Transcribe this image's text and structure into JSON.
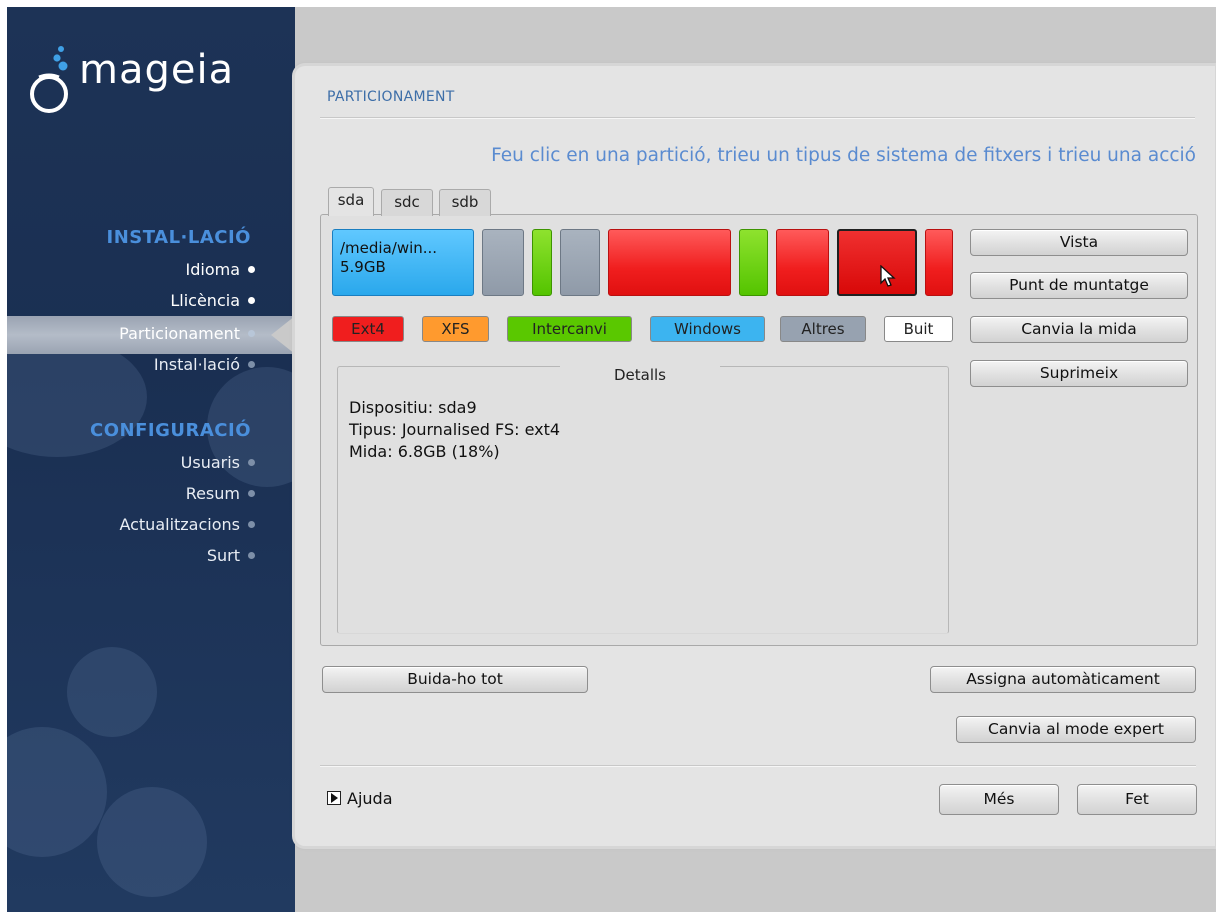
{
  "sidebar": {
    "logo_text": "mageia",
    "sections": [
      {
        "title": "INSTAL·LACIÓ"
      },
      {
        "title": "CONFIGURACIÓ"
      }
    ],
    "steps": [
      {
        "label": "Idioma"
      },
      {
        "label": "Llicència"
      },
      {
        "label": "Particionament"
      },
      {
        "label": "Instal·lació"
      },
      {
        "label": "Usuaris"
      },
      {
        "label": "Resum"
      },
      {
        "label": "Actualitzacions"
      },
      {
        "label": "Surt"
      }
    ]
  },
  "header": {
    "title": "PARTICIONAMENT",
    "instruction": "Feu clic en una partició, trieu un tipus de sistema de fitxers i trieu una acció"
  },
  "tabs": [
    {
      "label": "sda"
    },
    {
      "label": "sdc"
    },
    {
      "label": "sdb"
    }
  ],
  "partitions": {
    "first_label_line1": "/media/win...",
    "first_label_line2": "5.9GB",
    "colors": {
      "ext4": "#f02020",
      "swap": "#5ac800",
      "other": "#97a2b0",
      "windows": "#2aa8ec"
    }
  },
  "legend": [
    {
      "label": "Ext4",
      "color": "#f01e1e"
    },
    {
      "label": "XFS",
      "color": "#ff9a2e"
    },
    {
      "label": "Intercanvi",
      "color": "#5ac800"
    },
    {
      "label": "Windows",
      "color": "#3cb4f0"
    },
    {
      "label": "Altres",
      "color": "#97a2b0"
    },
    {
      "label": "Buit",
      "color": "#ffffff"
    }
  ],
  "actions": {
    "view": "Vista",
    "mount_point": "Punt de muntatge",
    "resize": "Canvia la mida",
    "delete": "Suprimeix"
  },
  "details": {
    "title": "Detalls",
    "device": "Dispositiu: sda9",
    "type": "Tipus: Journalised FS: ext4",
    "size": "Mida: 6.8GB (18%)"
  },
  "bottom": {
    "clear_all": "Buida-ho tot",
    "auto_allocate": "Assigna automàticament",
    "expert_mode": "Canvia al mode expert",
    "help": "Ajuda",
    "more": "Més",
    "done": "Fet"
  }
}
